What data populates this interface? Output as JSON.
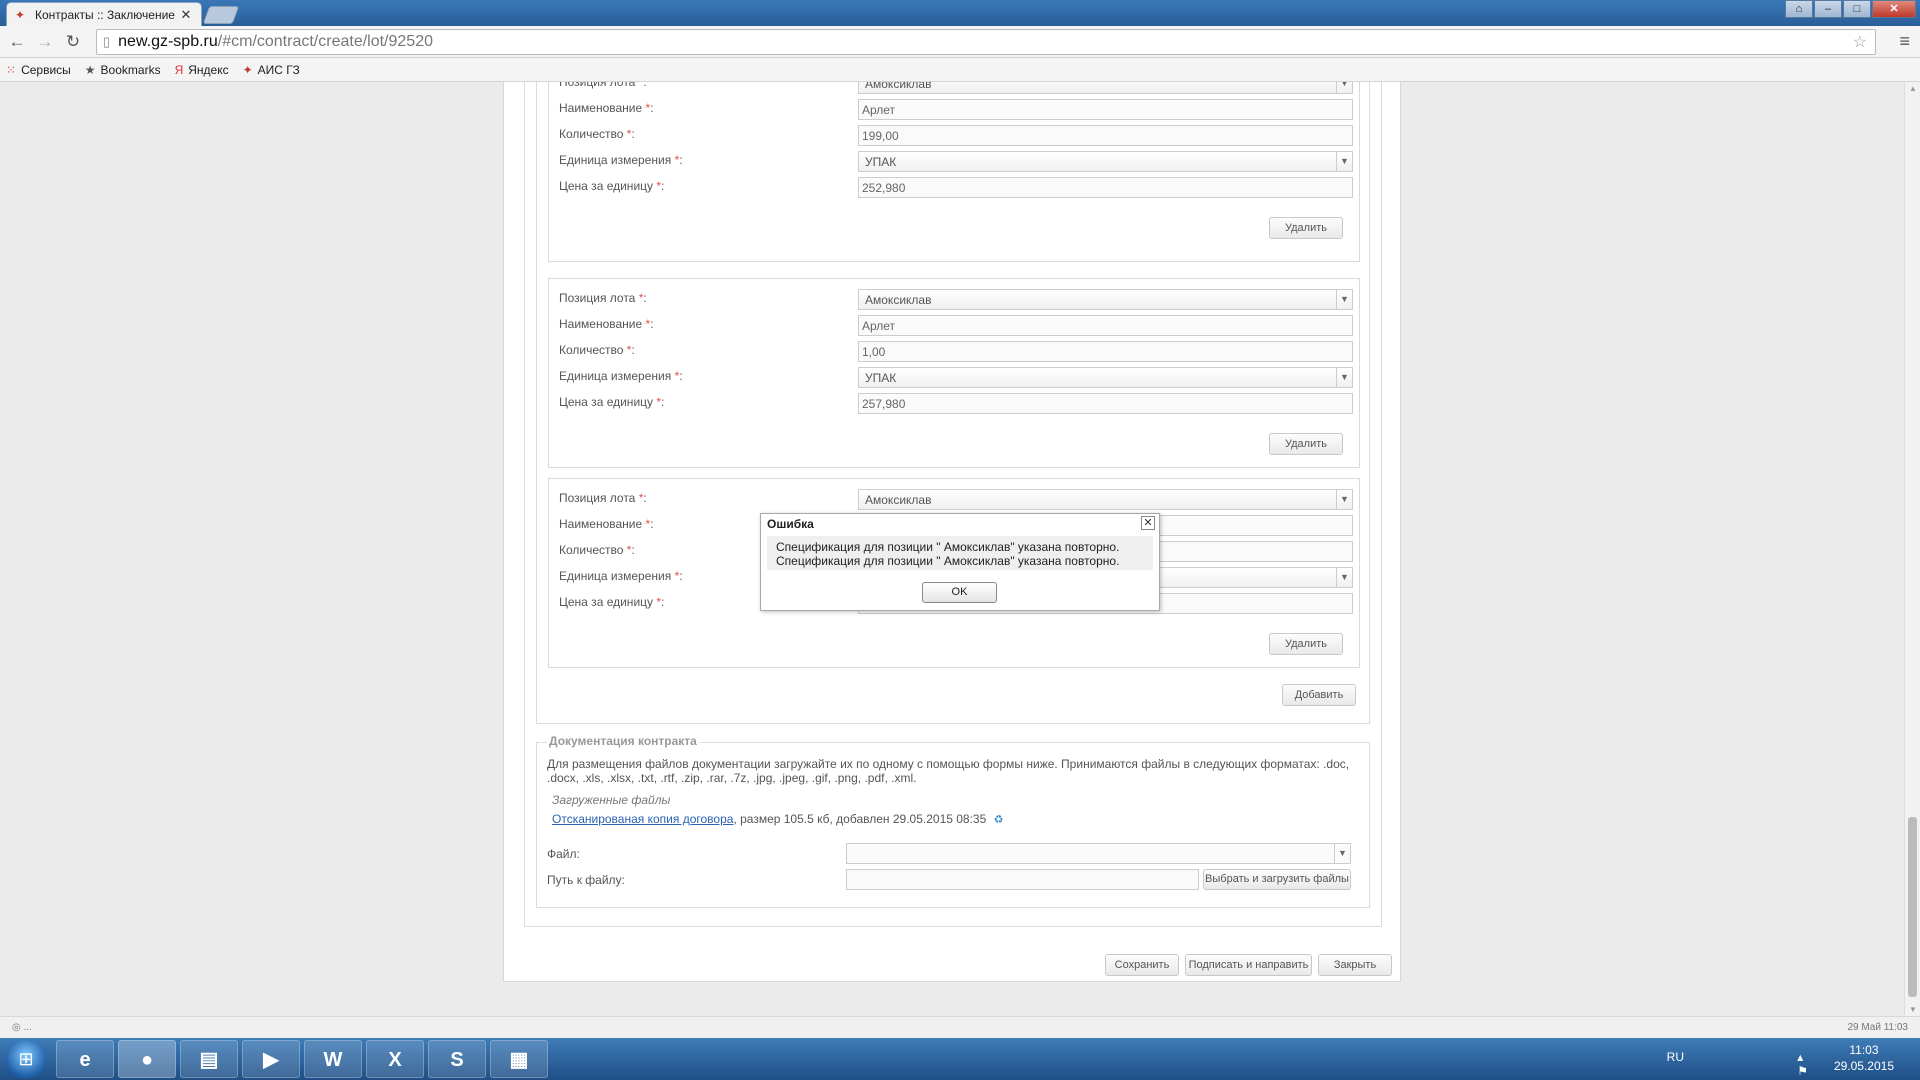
{
  "browser": {
    "tab_title": "Контракты :: Заключение",
    "url_host": "new.gz-spb.ru",
    "url_path": "/#cm/contract/create/lot/92520",
    "bookmarks": [
      {
        "label": "Сервисы",
        "icon": "apps-grid-icon"
      },
      {
        "label": "Bookmarks",
        "icon": "star-icon"
      },
      {
        "label": "Яндекс",
        "icon": "yandex-icon"
      },
      {
        "label": "АИС ГЗ",
        "icon": "ais-icon"
      }
    ]
  },
  "form": {
    "labels": {
      "position": "Позиция лота",
      "name": "Наименование",
      "quantity": "Количество",
      "unit": "Единица измерения",
      "price": "Цена за единицу",
      "required_mark": "*",
      "colon": ":"
    },
    "positions": [
      {
        "position": "Амоксиклав",
        "name": "Арлет",
        "quantity": "199,00",
        "unit": "УПАК",
        "price": "252,980",
        "delete_label": "Удалить"
      },
      {
        "position": "Амоксиклав",
        "name": "Арлет",
        "quantity": "1,00",
        "unit": "УПАК",
        "price": "257,980",
        "delete_label": "Удалить"
      },
      {
        "position": "Амоксиклав",
        "name": "",
        "quantity": "",
        "unit": "",
        "price": "",
        "delete_label": "Удалить"
      }
    ],
    "add_label": "Добавить"
  },
  "documents": {
    "legend": "Документация контракта",
    "description": "Для размещения файлов документации загружайте их по одному с помощью формы ниже. Принимаются файлы в следующих форматах: .doc, .docx, .xls, .xlsx, .txt, .rtf, .zip, .rar, .7z, .jpg, .jpeg, .gif, .png, .pdf, .xml.",
    "uploaded_label": "Загруженные файлы",
    "file_link": "Отсканированая копия договора",
    "file_info": ", размер 105.5 кб, добавлен 29.05.2015 08:35",
    "file_label": "Файл:",
    "path_label": "Путь к файлу:",
    "upload_button": "Выбрать и загрузить файлы"
  },
  "actions": {
    "save": "Сохранить",
    "sign": "Подписать и направить",
    "close": "Закрыть"
  },
  "dialog": {
    "title": "Ошибка",
    "line1": "Спецификация для позиции \" Амоксиклав\" указана повторно.",
    "line2": "Спецификация для позиции \" Амоксиклав\" указана повторно.",
    "ok": "OK"
  },
  "status": {
    "left": "◎ ...",
    "right": "29 Май 11:03"
  },
  "taskbar": {
    "apps": [
      "ie-icon",
      "chrome-icon",
      "explorer-icon",
      "media-player-icon",
      "word-icon",
      "excel-icon",
      "skype-icon",
      "winrar-icon"
    ],
    "app_glyphs": [
      "e",
      "●",
      "▤",
      "▶",
      "W",
      "X",
      "S",
      "▦"
    ],
    "lang": "RU",
    "time": "11:03",
    "date": "29.05.2015"
  },
  "colors": {
    "required": "#e05050",
    "link": "#2b62b5",
    "taskbar": "#2a5e98"
  }
}
